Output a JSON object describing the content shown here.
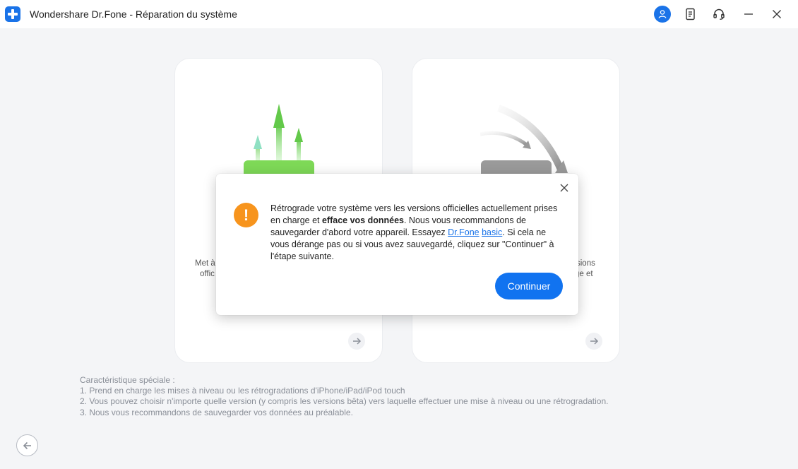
{
  "window": {
    "title": "Wondershare Dr.Fone - Réparation du système"
  },
  "cards": {
    "left": {
      "desc_line1": "Met à",
      "desc_line2": "offic"
    },
    "right": {
      "desc_line1": "sions",
      "desc_line2": "ge et"
    }
  },
  "dialog": {
    "text_part1": "Rétrograde votre système vers les versions officielles actuellement prises en charge et ",
    "text_bold": "efface vos données",
    "text_part2": ". Nous vous recommandons de sauvegarder d'abord votre appareil. Essayez ",
    "link1": "Dr.Fone",
    "link2": "basic",
    "text_part3": ". Si cela ne vous dérange pas ou si vous avez sauvegardé, cliquez sur \"Continuer\" à l'étape suivante.",
    "continue_label": "Continuer"
  },
  "features": {
    "heading": "Caractéristique spéciale :",
    "items": [
      "1. Prend en charge les mises à niveau ou les rétrogradations d'iPhone/iPad/iPod touch",
      "2. Vous pouvez choisir n'importe quelle version (y compris les versions bêta) vers laquelle effectuer une mise à niveau ou une rétrogradation.",
      "3. Nous vous recommandons de sauvegarder vos données au préalable."
    ]
  },
  "colors": {
    "accent": "#1173f0",
    "warning": "#f7941d",
    "upgrade_green": "#7ed957",
    "downgrade_gray": "#9a9a9a"
  }
}
